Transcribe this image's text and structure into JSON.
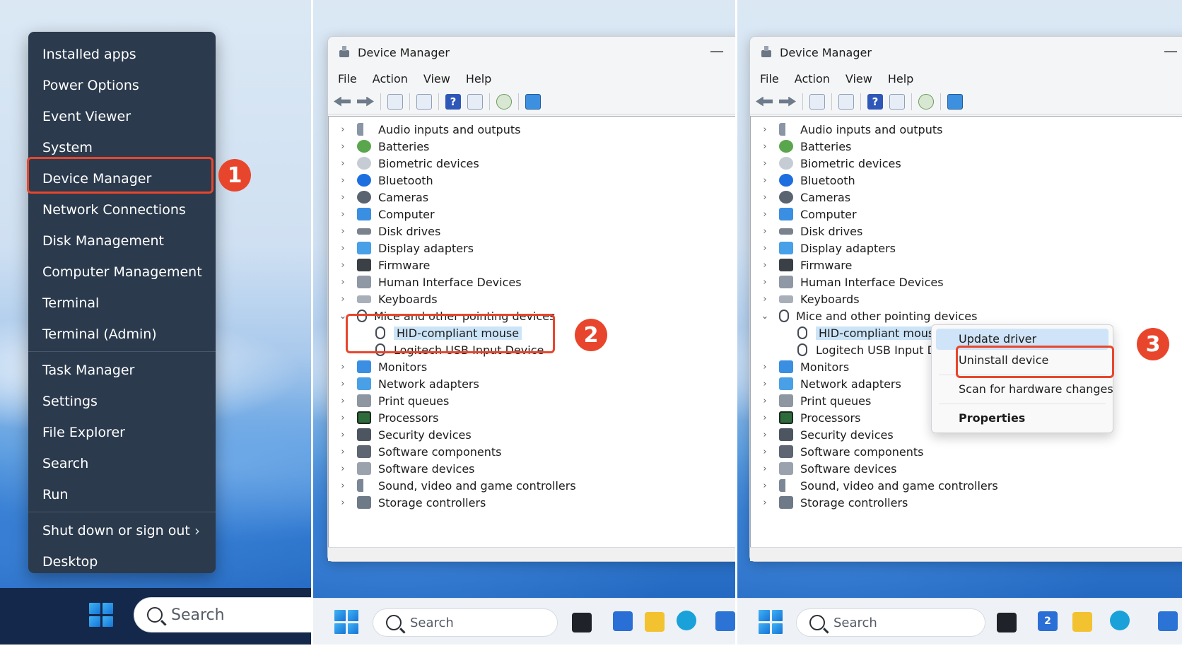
{
  "panel1": {
    "menu_items": [
      "Installed apps",
      "Power Options",
      "Event Viewer",
      "System",
      "Device Manager",
      "Network Connections",
      "Disk Management",
      "Computer Management",
      "Terminal",
      "Terminal (Admin)"
    ],
    "menu_items_2": [
      "Task Manager",
      "Settings",
      "File Explorer",
      "Search",
      "Run"
    ],
    "menu_items_3": [
      "Shut down or sign out",
      "Desktop"
    ],
    "shutdown_chevron": "›",
    "search_placeholder": "Search",
    "step": "1"
  },
  "device_manager": {
    "title": "Device Manager",
    "minimize": "—",
    "menus": [
      "File",
      "Action",
      "View",
      "Help"
    ],
    "help_tool": "?",
    "categories": [
      "Audio inputs and outputs",
      "Batteries",
      "Biometric devices",
      "Bluetooth",
      "Cameras",
      "Computer",
      "Disk drives",
      "Display adapters",
      "Firmware",
      "Human Interface Devices",
      "Keyboards",
      "Mice and other pointing devices"
    ],
    "mouse_children": [
      "HID-compliant mouse",
      "Logitech USB Input Device"
    ],
    "mouse_children_truncated": [
      "HID-compliant mouse",
      "Logitech USB Input De"
    ],
    "categories_after": [
      "Monitors",
      "Network adapters",
      "Print queues",
      "Processors",
      "Security devices",
      "Software components",
      "Software devices",
      "Sound, video and game controllers",
      "Storage controllers"
    ],
    "collapsed_chevron": "›",
    "expanded_chevron": "⌄"
  },
  "panel2": {
    "step": "2",
    "search_placeholder": "Search"
  },
  "panel3": {
    "step": "3",
    "search_placeholder": "Search",
    "badge": "2",
    "context_menu": {
      "update": "Update driver",
      "uninstall": "Uninstall device",
      "scan": "Scan for hardware changes",
      "properties": "Properties"
    }
  },
  "colors": {
    "accent": "#e8462c",
    "selection": "#cce4f7",
    "menu_bg": "#2b3a4d"
  }
}
